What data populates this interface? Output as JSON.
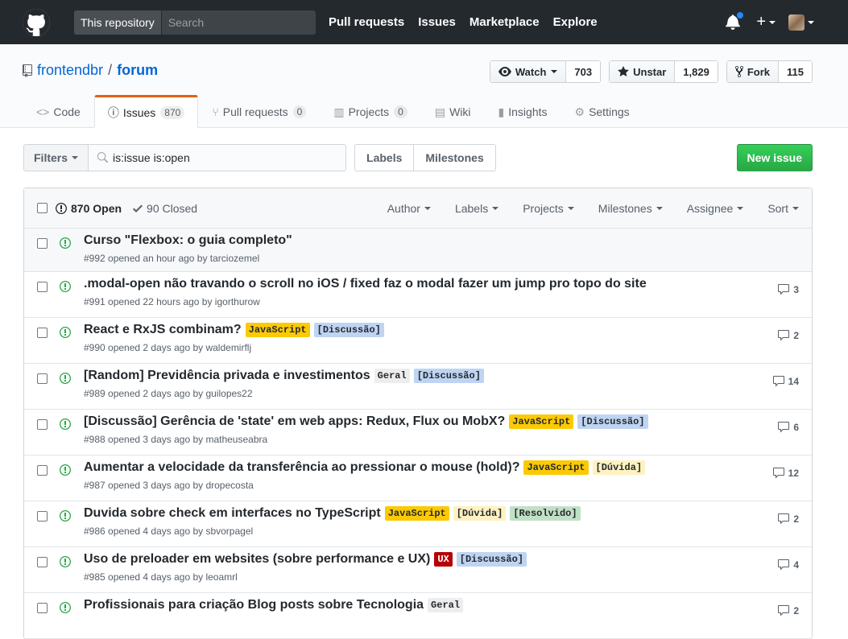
{
  "header": {
    "search_scope": "This repository",
    "search_placeholder": "Search",
    "nav": [
      "Pull requests",
      "Issues",
      "Marketplace",
      "Explore"
    ]
  },
  "repo": {
    "owner": "frontendbr",
    "name": "forum",
    "watch": {
      "label": "Watch",
      "count": "703"
    },
    "star": {
      "label": "Unstar",
      "count": "1,829"
    },
    "fork": {
      "label": "Fork",
      "count": "115"
    }
  },
  "tabs": [
    {
      "label": "Code",
      "icon": "code-icon"
    },
    {
      "label": "Issues",
      "count": "870",
      "icon": "issue-icon"
    },
    {
      "label": "Pull requests",
      "count": "0",
      "icon": "pr-icon"
    },
    {
      "label": "Projects",
      "count": "0",
      "icon": "project-icon"
    },
    {
      "label": "Wiki",
      "icon": "book-icon"
    },
    {
      "label": "Insights",
      "icon": "graph-icon"
    },
    {
      "label": "Settings",
      "icon": "gear-icon"
    }
  ],
  "subnav": {
    "filters": "Filters",
    "query": "is:issue is:open",
    "labels": "Labels",
    "milestones": "Milestones",
    "new_issue": "New issue"
  },
  "list_header": {
    "open": "870 Open",
    "closed": "90 Closed",
    "sorts": [
      "Author",
      "Labels",
      "Projects",
      "Milestones",
      "Assignee",
      "Sort"
    ]
  },
  "colors": {
    "open_icon": "#28a745",
    "accent": "#e36209",
    "link": "#0366d6"
  },
  "issues": [
    {
      "title": "Curso \"Flexbox: o guia completo\"",
      "meta": "#992 opened an hour ago by tarciozemel",
      "comments": "",
      "labels": []
    },
    {
      "title": ".modal-open não travando o scroll no iOS / fixed faz o modal fazer um jump pro topo do site",
      "meta": "#991 opened 22 hours ago by igorthurow",
      "comments": "3",
      "labels": []
    },
    {
      "title": "React e RxJS combinam?",
      "meta": "#990 opened 2 days ago by waldemirflj",
      "comments": "2",
      "labels": [
        {
          "text": "JavaScript",
          "bg": "#fbca04",
          "fg": "#24292e"
        },
        {
          "text": "[Discussão]",
          "bg": "#bfd4f2",
          "fg": "#24292e"
        }
      ]
    },
    {
      "title": "[Random] Previdência privada e investimentos",
      "meta": "#989 opened 2 days ago by guilopes22",
      "comments": "14",
      "labels": [
        {
          "text": "Geral",
          "bg": "#ededed",
          "fg": "#24292e"
        },
        {
          "text": "[Discussão]",
          "bg": "#bfd4f2",
          "fg": "#24292e"
        }
      ]
    },
    {
      "title": "[Discussão] Gerência de 'state' em web apps: Redux, Flux ou MobX?",
      "meta": "#988 opened 3 days ago by matheuseabra",
      "comments": "6",
      "labels": [
        {
          "text": "JavaScript",
          "bg": "#fbca04",
          "fg": "#24292e"
        },
        {
          "text": "[Discussão]",
          "bg": "#bfd4f2",
          "fg": "#24292e"
        }
      ]
    },
    {
      "title": "Aumentar a velocidade da transferência ao pressionar o mouse (hold)?",
      "meta": "#987 opened 3 days ago by dropecosta",
      "comments": "12",
      "labels": [
        {
          "text": "JavaScript",
          "bg": "#fbca04",
          "fg": "#24292e"
        },
        {
          "text": "[Dúvida]",
          "bg": "#fef2c0",
          "fg": "#24292e"
        }
      ]
    },
    {
      "title": "Duvida sobre check em interfaces no TypeScript",
      "meta": "#986 opened 4 days ago by sbvorpagel",
      "comments": "2",
      "labels": [
        {
          "text": "JavaScript",
          "bg": "#fbca04",
          "fg": "#24292e"
        },
        {
          "text": "[Dúvida]",
          "bg": "#fef2c0",
          "fg": "#24292e"
        },
        {
          "text": "[Resolvido]",
          "bg": "#c2e0c6",
          "fg": "#24292e"
        }
      ]
    },
    {
      "title": "Uso de preloader em websites (sobre performance e UX)",
      "meta": "#985 opened 4 days ago by leoamrl",
      "comments": "4",
      "labels": [
        {
          "text": "UX",
          "bg": "#b60205",
          "fg": "#ffffff"
        },
        {
          "text": "[Discussão]",
          "bg": "#bfd4f2",
          "fg": "#24292e"
        }
      ]
    },
    {
      "title": "Profissionais para criação Blog posts sobre Tecnologia",
      "meta": "",
      "comments": "2",
      "labels": [
        {
          "text": "Geral",
          "bg": "#ededed",
          "fg": "#24292e"
        }
      ]
    }
  ]
}
